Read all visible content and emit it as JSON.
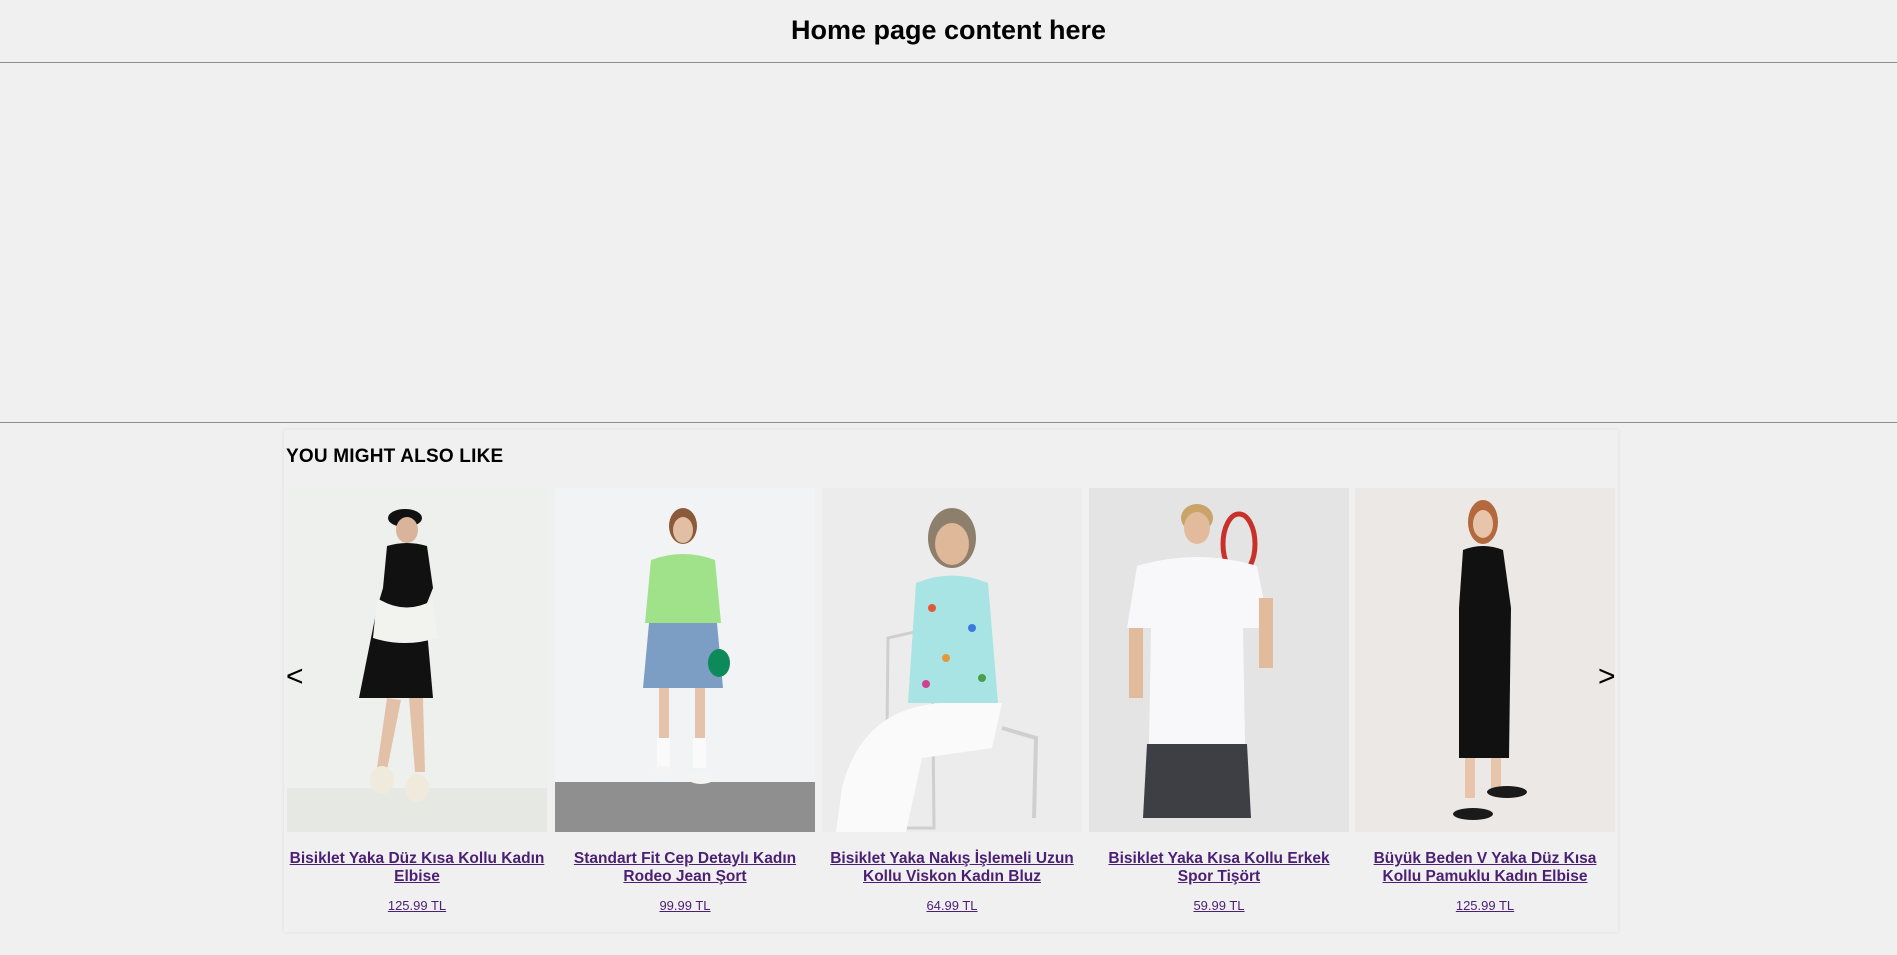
{
  "header": {
    "title": "Home page content here"
  },
  "recommendations": {
    "heading": "YOU MIGHT ALSO LIKE",
    "prev_label": "<",
    "next_label": ">",
    "products": [
      {
        "name": "Bisiklet Yaka Düz Kısa Kollu Kadın Elbise",
        "price": "125.99 TL",
        "photo": "woman-black-dress-cap"
      },
      {
        "name": "Standart Fit Cep Detaylı Kadın Rodeo Jean Şort",
        "price": "99.99 TL",
        "photo": "woman-green-shirt-denim-shorts"
      },
      {
        "name": "Bisiklet Yaka Nakış İşlemeli Uzun Kollu Viskon Kadın Bluz",
        "price": "64.99 TL",
        "photo": "woman-floral-blouse-chair"
      },
      {
        "name": "Bisiklet Yaka Kısa Kollu Erkek Spor Tişört",
        "price": "59.99 TL",
        "photo": "man-white-tshirt-racket"
      },
      {
        "name": "Büyük Beden V Yaka Düz Kısa Kollu Pamuklu Kadın Elbise",
        "price": "125.99 TL",
        "photo": "woman-long-black-dress"
      }
    ]
  }
}
